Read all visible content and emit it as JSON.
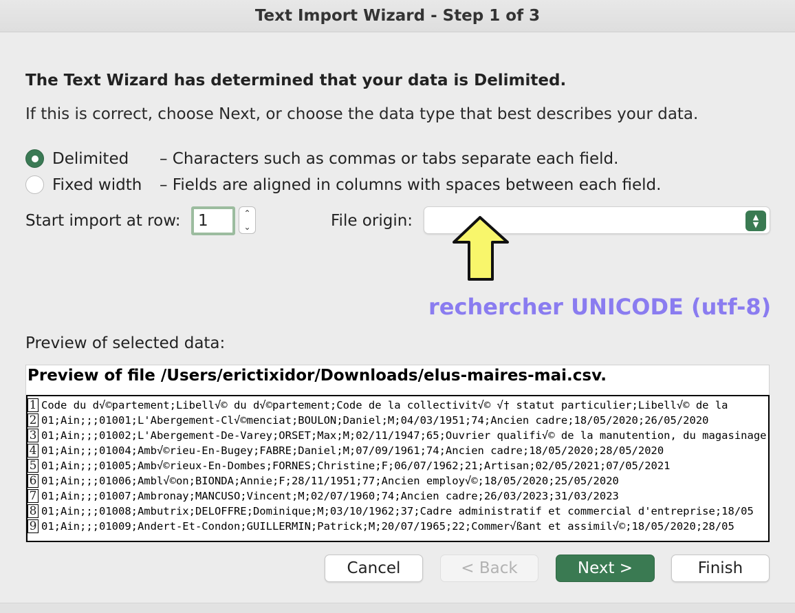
{
  "window": {
    "title": "Text Import Wizard - Step 1 of 3"
  },
  "intro": {
    "heading": "The Text Wizard has determined that your data is Delimited.",
    "subtext": "If this is correct, choose Next, or choose the data type that best describes your data."
  },
  "data_type": {
    "options": [
      {
        "label": "Delimited",
        "description": "– Characters such as commas or tabs separate each field.",
        "selected": true
      },
      {
        "label": "Fixed width",
        "description": "– Fields are aligned in columns with spaces between each field.",
        "selected": false
      }
    ]
  },
  "start_row": {
    "label": "Start import at row:",
    "value": "1",
    "stepper_up": "⌃",
    "stepper_down": "⌄"
  },
  "file_origin": {
    "label": "File origin:",
    "value": "",
    "chevron_up": "▲",
    "chevron_down": "▼"
  },
  "annotation": {
    "text": "rechercher UNICODE (utf-8)",
    "arrow_color": "#f8f66b"
  },
  "preview": {
    "label": "Preview of selected data:",
    "title": "Preview of file /Users/erictixidor/Downloads/elus-maires-mai.csv.",
    "rows": [
      {
        "num": "1",
        "text": "Code du d√©partement;Libell√© du d√©partement;Code de la collectivit√© √† statut particulier;Libell√© de la"
      },
      {
        "num": "2",
        "text": "01;Ain;;;01001;L'Abergement-Cl√©menciat;BOULON;Daniel;M;04/03/1951;74;Ancien cadre;18/05/2020;26/05/2020"
      },
      {
        "num": "3",
        "text": "01;Ain;;;01002;L'Abergement-De-Varey;ORSET;Max;M;02/11/1947;65;Ouvrier qualifi√© de la manutention, du magasinage"
      },
      {
        "num": "4",
        "text": "01;Ain;;;01004;Amb√©rieu-En-Bugey;FABRE;Daniel;M;07/09/1961;74;Ancien cadre;18/05/2020;28/05/2020"
      },
      {
        "num": "5",
        "text": "01;Ain;;;01005;Amb√©rieux-En-Dombes;FORNES;Christine;F;06/07/1962;21;Artisan;02/05/2021;07/05/2021"
      },
      {
        "num": "6",
        "text": "01;Ain;;;01006;Ambl√©on;BIONDA;Annie;F;28/11/1951;77;Ancien employ√©;18/05/2020;25/05/2020"
      },
      {
        "num": "7",
        "text": "01;Ain;;;01007;Ambronay;MANCUSO;Vincent;M;02/07/1960;74;Ancien cadre;26/03/2023;31/03/2023"
      },
      {
        "num": "8",
        "text": "01;Ain;;;01008;Ambutrix;DELOFFRE;Dominique;M;03/10/1962;37;Cadre administratif et commercial d'entreprise;18/05"
      },
      {
        "num": "9",
        "text": "01;Ain;;;01009;Andert-Et-Condon;GUILLERMIN;Patrick;M;20/07/1965;22;Commer√ßant et assimil√©;18/05/2020;28/05"
      }
    ]
  },
  "buttons": {
    "cancel": "Cancel",
    "back": "< Back",
    "next": "Next >",
    "finish": "Finish"
  },
  "colors": {
    "accent": "#3a7a52",
    "annotation": "#8a7cf0"
  }
}
